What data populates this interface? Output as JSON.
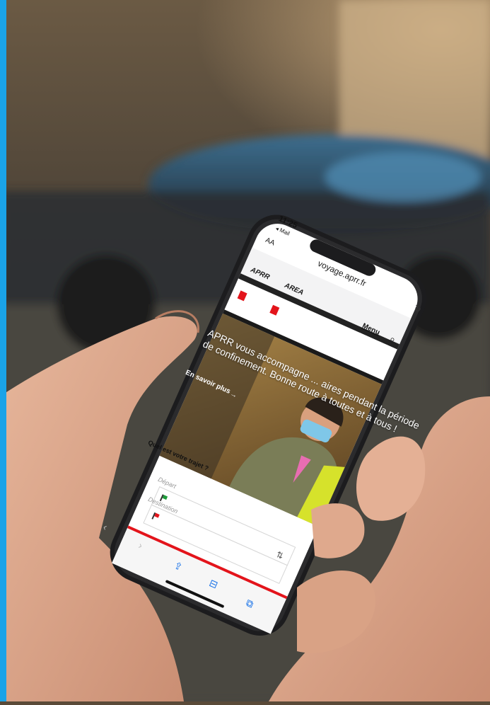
{
  "status_bar": {
    "time": "11:25",
    "back_app": "◂ Mail"
  },
  "browser": {
    "aa_label": "AA",
    "url": "voyage.aprr.fr",
    "reload_icon": "reload-icon"
  },
  "site": {
    "logos": [
      "APRR",
      "AREA"
    ],
    "menu_label": "Menu",
    "hero_text": "APRR vous accompagne ... aires pendant la période de confinement. Bonne route à toutes et à tous !",
    "hero_link": "En savoir plus",
    "trip_question": "Quel est votre trajet ?",
    "departure_placeholder": "Départ",
    "destination_placeholder": "Destination"
  },
  "toolbar": {
    "icons": [
      "back-icon",
      "forward-icon",
      "share-icon",
      "bookmarks-icon",
      "tabs-icon"
    ]
  },
  "colors": {
    "accent": "#1aa3e8",
    "brand_red": "#e3141b",
    "phone_frame": "#1c1c1e"
  }
}
